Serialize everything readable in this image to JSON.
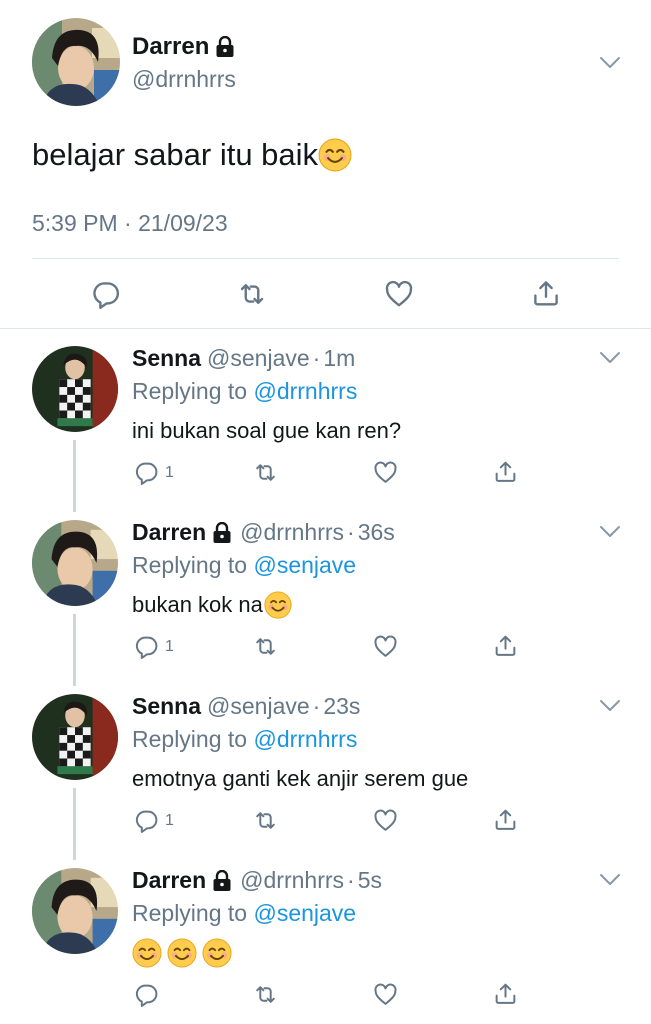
{
  "main_tweet": {
    "author_name": "Darren",
    "handle": "@drrnhrrs",
    "text": "belajar sabar itu baik",
    "timestamp": "5:39 PM · 21/09/23",
    "icons": [
      "lock-icon",
      "chevron-down-icon",
      "reply-icon",
      "retweet-icon",
      "like-icon",
      "share-icon",
      "smiling-face-emoji"
    ]
  },
  "replies": [
    {
      "author_name": "Senna",
      "handle": "@senjave",
      "time": "1m",
      "replying_prefix": "Replying to",
      "replying_to": "@drrnhrrs",
      "text": "ini bukan soal gue kan ren?",
      "reply_count": "1"
    },
    {
      "author_name": "Darren",
      "handle": "@drrnhrrs",
      "time": "36s",
      "replying_prefix": "Replying to",
      "replying_to": "@senjave",
      "text": "bukan kok na",
      "reply_count": "1"
    },
    {
      "author_name": "Senna",
      "handle": "@senjave",
      "time": "23s",
      "replying_prefix": "Replying to",
      "replying_to": "@drrnhrrs",
      "text": "emotnya ganti kek anjir serem gue",
      "reply_count": "1"
    },
    {
      "author_name": "Darren",
      "handle": "@drrnhrrs",
      "time": "5s",
      "replying_prefix": "Replying to",
      "replying_to": "@senjave",
      "text": "",
      "reply_count": ""
    }
  ],
  "separator": "·",
  "colors": {
    "text": "#14171a",
    "secondary": "#657786",
    "link": "#1b95e0",
    "divider": "#e1e8ed",
    "thread_line": "#ccd6dd"
  }
}
